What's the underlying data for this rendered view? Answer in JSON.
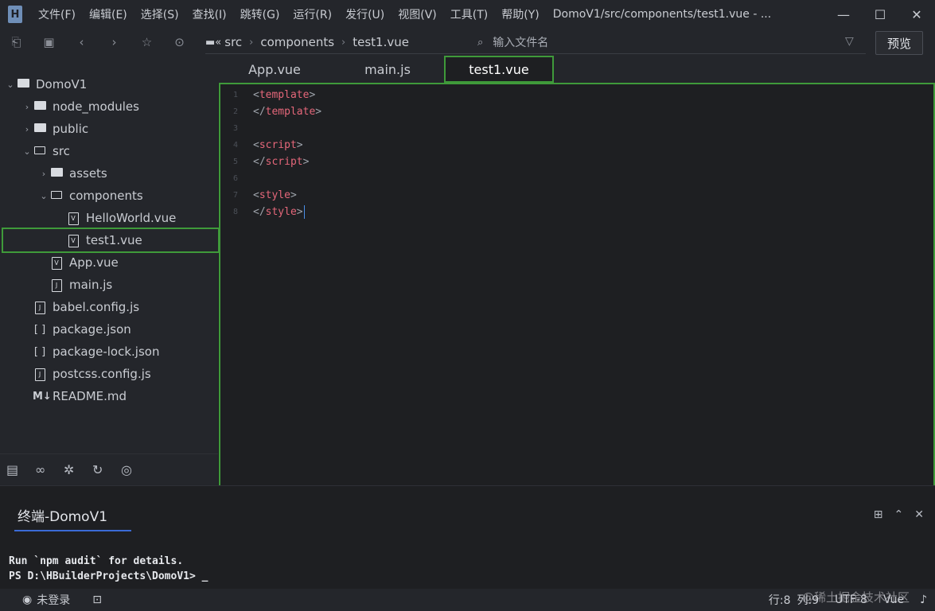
{
  "titlebar": {
    "menus": [
      "文件(F)",
      "编辑(E)",
      "选择(S)",
      "查找(I)",
      "跳转(G)",
      "运行(R)",
      "发行(U)",
      "视图(V)",
      "工具(T)",
      "帮助(Y)"
    ],
    "window_title": "DomoV1/src/components/test1.vue - ..."
  },
  "toolbar": {
    "breadcrumbs": [
      "src",
      "components",
      "test1.vue"
    ],
    "search_placeholder": "输入文件名",
    "preview_label": "预览"
  },
  "sidebar": {
    "tree": [
      {
        "label": "DomoV1",
        "type": "project",
        "expanded": true
      },
      {
        "label": "node_modules",
        "type": "folder",
        "expanded": false
      },
      {
        "label": "public",
        "type": "folder",
        "expanded": false
      },
      {
        "label": "src",
        "type": "folder",
        "expanded": true
      },
      {
        "label": "assets",
        "type": "folder",
        "expanded": false
      },
      {
        "label": "components",
        "type": "folder",
        "expanded": true
      },
      {
        "label": "HelloWorld.vue",
        "type": "vue"
      },
      {
        "label": "test1.vue",
        "type": "vue",
        "selected": true
      },
      {
        "label": "App.vue",
        "type": "vue"
      },
      {
        "label": "main.js",
        "type": "js"
      },
      {
        "label": "babel.config.js",
        "type": "js"
      },
      {
        "label": "package.json",
        "type": "json"
      },
      {
        "label": "package-lock.json",
        "type": "json"
      },
      {
        "label": "postcss.config.js",
        "type": "js"
      },
      {
        "label": "README.md",
        "type": "md"
      }
    ]
  },
  "tabs": [
    {
      "label": "App.vue",
      "active": false
    },
    {
      "label": "main.js",
      "active": false
    },
    {
      "label": "test1.vue",
      "active": true
    }
  ],
  "editor": {
    "lines": [
      {
        "num": "1",
        "open": "<",
        "tag": "template",
        "close": ">"
      },
      {
        "num": "2",
        "open": "</",
        "tag": "template",
        "close": ">"
      },
      {
        "num": "3",
        "open": "",
        "tag": "",
        "close": ""
      },
      {
        "num": "4",
        "open": "<",
        "tag": "script",
        "close": ">"
      },
      {
        "num": "5",
        "open": "</",
        "tag": "script",
        "close": ">"
      },
      {
        "num": "6",
        "open": "",
        "tag": "",
        "close": ""
      },
      {
        "num": "7",
        "open": "<",
        "tag": "style",
        "close": ">"
      },
      {
        "num": "8",
        "open": "</",
        "tag": "style",
        "close": ">"
      }
    ]
  },
  "terminal": {
    "tab_label": "终端-DomoV1",
    "lines": [
      "Run `npm audit` for details.",
      "PS D:\\HBuilderProjects\\DomoV1> _"
    ]
  },
  "statusbar": {
    "login": "未登录",
    "row": "行:8",
    "col": "列:9",
    "encoding": "UTF-8",
    "language": "Vue"
  },
  "watermark": "@稀土掘金技术社区",
  "colors": {
    "highlight_border": "#3f9a3a",
    "tag_name": "#e5677a",
    "cursor": "#4a8ee8"
  }
}
